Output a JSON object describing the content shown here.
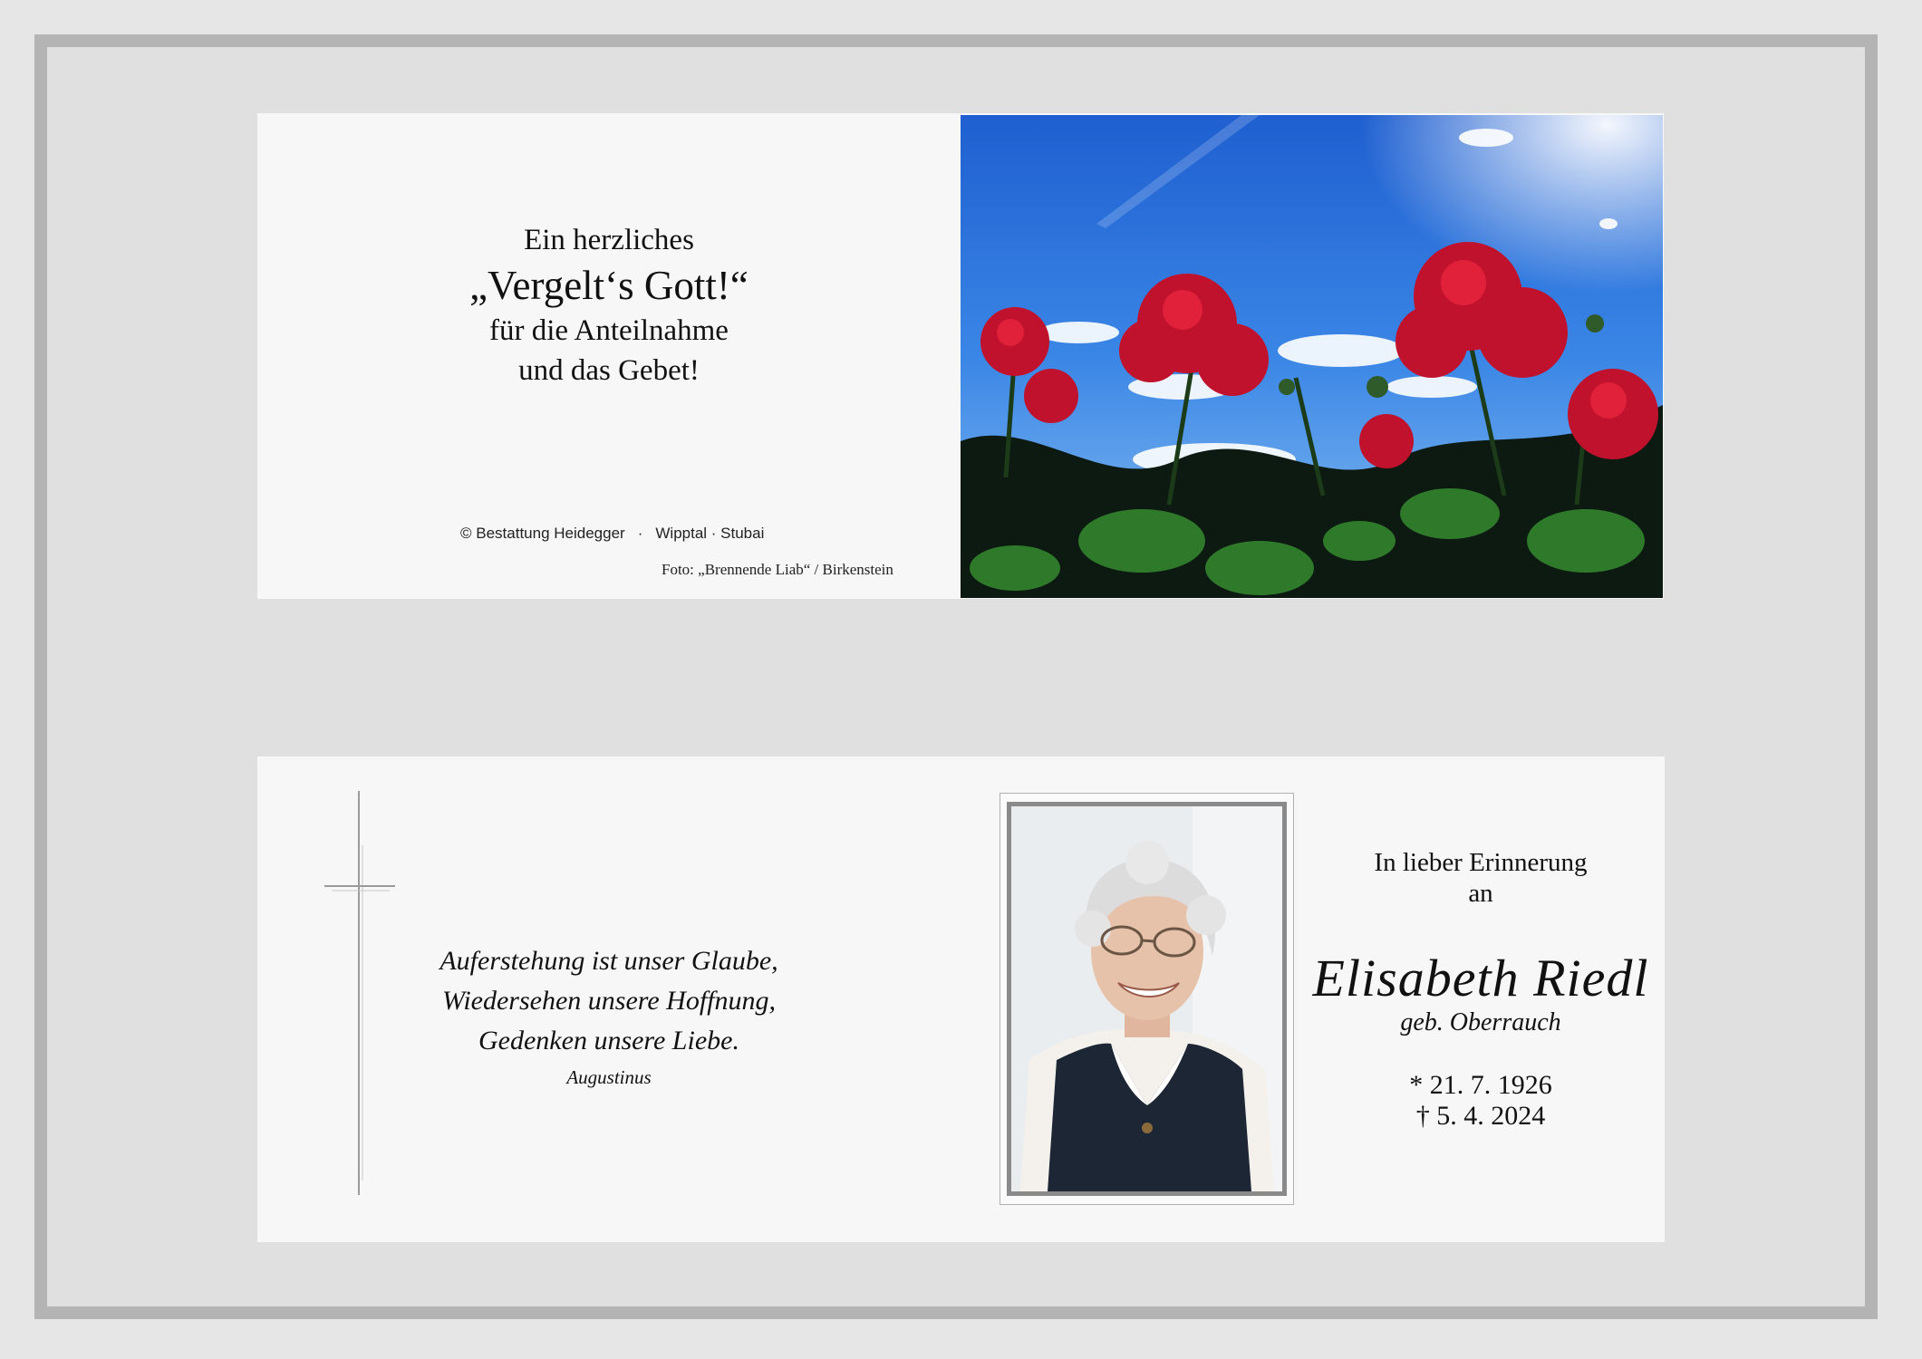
{
  "top_card": {
    "thanks": {
      "line1": "Ein herzliches",
      "line2": "„Vergelt‘s Gott!“",
      "line3": "für die Anteilnahme",
      "line4": "und das Gebet!"
    },
    "copyright": "© Bestattung Heidegger",
    "separator": "·",
    "region": "Wipptal · Stubai",
    "photo_credit": "Foto: „Brennende Liab“ / Birkenstein",
    "photo_subject": "red geraniums against a blue sky"
  },
  "bottom_card": {
    "quote": {
      "line1": "Auferstehung ist unser Glaube,",
      "line2": "Wiedersehen unsere Hoffnung,",
      "line3": "Gedenken unsere Liebe.",
      "author": "Augustinus"
    },
    "intro_line1": "In lieber Erinnerung",
    "intro_line2": "an",
    "name": "Elisabeth Riedl",
    "maiden_name": "geb. Oberrauch",
    "birth": "* 21. 7. 1926",
    "death": "† 5. 4. 2024"
  },
  "colors": {
    "frame_border": "#b4b4b4",
    "card_background": "#f7f7f7",
    "sky_blue": "#2a6fd6",
    "flower_red": "#c0122c"
  }
}
